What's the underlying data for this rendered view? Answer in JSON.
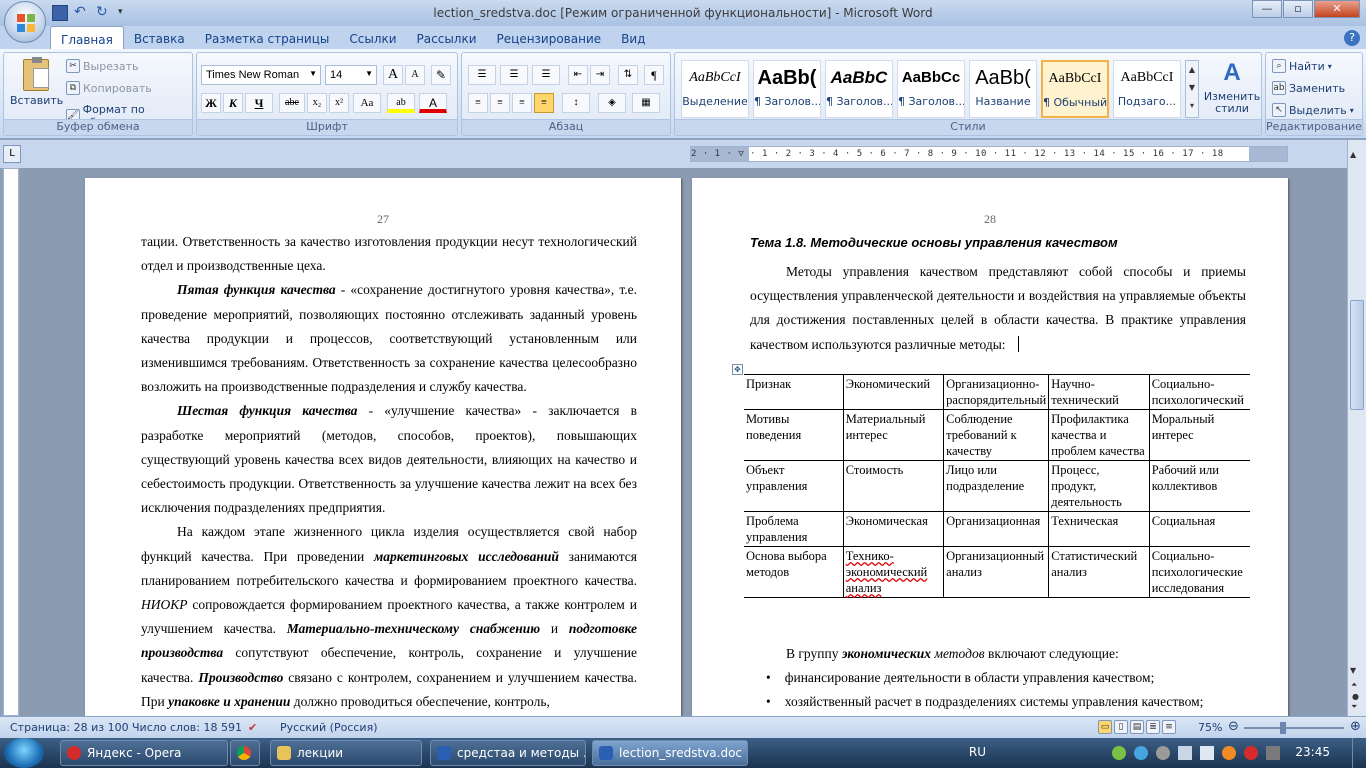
{
  "window": {
    "title": "lection_sredstva.doc [Режим ограниченной функциональности] - Microsoft Word",
    "minimize": "—",
    "maximize": "▫",
    "close": "✕"
  },
  "ribbon_tabs": [
    "Главная",
    "Вставка",
    "Разметка страницы",
    "Ссылки",
    "Рассылки",
    "Рецензирование",
    "Вид"
  ],
  "help": "?",
  "clipboard": {
    "paste": "Вставить",
    "cut": "Вырезать",
    "copy": "Копировать",
    "format_painter": "Формат по образцу",
    "label": "Буфер обмена"
  },
  "font": {
    "name": "Times New Roman",
    "size": "14",
    "grow": "A",
    "shrink": "A",
    "clear": "✎",
    "bold": "Ж",
    "italic": "К",
    "underline": "Ч",
    "strike": "abe",
    "sub": "x₂",
    "sup": "x²",
    "case": "Aa",
    "highlight": "ab",
    "color": "A",
    "label": "Шрифт"
  },
  "paragraph": {
    "label": "Абзац",
    "pilcrow": "¶"
  },
  "styles": {
    "label": "Стили",
    "items": [
      {
        "sample": "AaBbCcI",
        "name": "Выделение"
      },
      {
        "sample": "AaBb(",
        "name": "¶ Заголов..."
      },
      {
        "sample": "AaBbC",
        "name": "¶ Заголов..."
      },
      {
        "sample": "AaBbCc",
        "name": "¶ Заголов..."
      },
      {
        "sample": "AaBb(",
        "name": "Название"
      },
      {
        "sample": "AaBbCcI",
        "name": "¶ Обычный"
      },
      {
        "sample": "AaBbCcI",
        "name": "Подзаго..."
      }
    ],
    "change": "Изменить стили"
  },
  "editing": {
    "find": "Найти",
    "replace": "Заменить",
    "select": "Выделить",
    "label": "Редактирование"
  },
  "ruler": {
    "ticks": "2 · 1 · ▽ · 1 · 2 · 3 · 4 · 5 · 6 · 7 · 8 · 9 · 10 · 11 · 12 · 13 · 14 · 15 · 16 · 17 · 18",
    "tab_selector": "L"
  },
  "page27": {
    "number": "27",
    "p1": "тации. Ответственность за качество изготовления продукции несут технологический отдел и производственные цеха.",
    "p2_head": "Пятая функция качества",
    "p2_rest": " - «сохранение достигнутого уровня качества», т.е. проведение мероприятий, позволяющих постоянно отслеживать заданный уровень качества продукции и процессов, соответствующий установленным или изменившимся требованиям. Ответственность за сохранение качества целесообразно возложить на производственные подразделения и службу качества.",
    "p3_head": "Шестая функция качества",
    "p3_rest": " - «улучшение качества» - заключается в разработке мероприятий (методов, способов, проектов), повышающих существующий уровень качества всех видов деятельности, влияющих на качество и себестоимость продукции. Ответственность за улучшение качества лежит на всех без исключения подразделениях предприятия.",
    "p4_a": "На каждом этапе жизненного цикла изделия осуществляется свой набор функций качества. При проведении ",
    "p4_b": "маркетинговых исследований",
    "p4_c": " занимаются планированием потребительского качества и формированием проектного качества. ",
    "p4_d": "НИОКР",
    "p4_e": " сопровождается формированием проектного качества, а также контролем и улучшением качества. ",
    "p4_f": "Материально-техническому снабжению",
    "p4_g": " и ",
    "p4_h": "подготовке производства",
    "p4_i": " сопутствуют обеспечение, контроль, сохранение и улучшение качества. ",
    "p4_j": "Производство",
    "p4_k": " связано с контролем, сохранением и улучшением качества. При ",
    "p4_l": "упаковке и хранении",
    "p4_m": " должно проводиться обеспечение, контроль,"
  },
  "page28": {
    "number": "28",
    "heading": "Тема 1.8. Методические основы управления качеством",
    "intro": "Методы управления качеством представляют собой способы и приемы осуществления управленческой деятельности и воздействия на управляемые объекты для достижения поставленных целей в области качества. В практике управления качеством используются различные методы:",
    "table": [
      [
        "Признак",
        "Экономический",
        "Организационно-распорядительный",
        "Научно-технический",
        "Социально-психологический"
      ],
      [
        "Мотивы поведения",
        "Материальный интерес",
        "Соблюдение требований к качеству",
        "Профилактика качества и проблем качества",
        "Моральный интерес"
      ],
      [
        "Объект управления",
        "Стоимость",
        "Лицо или подразделение",
        "Процесс, продукт, деятельность",
        "Рабочий или коллективов"
      ],
      [
        "Проблема управления",
        "Экономическая",
        "Организационная",
        "Техническая",
        "Социальная"
      ],
      [
        "Основа выбора методов",
        "Технико-экономический анализ",
        "Организационный анализ",
        "Статистический анализ",
        "Социально-психологические исследования"
      ]
    ],
    "group_a": "В группу ",
    "group_b": "экономических",
    "group_c": " методов",
    "group_d": " включают следующие:",
    "bullets": [
      "финансирование деятельности в области управления качеством;",
      "хозяйственный расчет в подразделениях системы управления качеством;"
    ]
  },
  "status": {
    "page": "Страница: 28 из 100",
    "words": "Число слов: 18 591",
    "lang": "Русский (Россия)",
    "zoom": "75%"
  },
  "taskbar": {
    "items": [
      "Яндекс - Opera",
      "лекции",
      "средстаа и методы ...",
      "lection_sredstva.doc ..."
    ],
    "lang": "RU",
    "time": "23:45"
  }
}
